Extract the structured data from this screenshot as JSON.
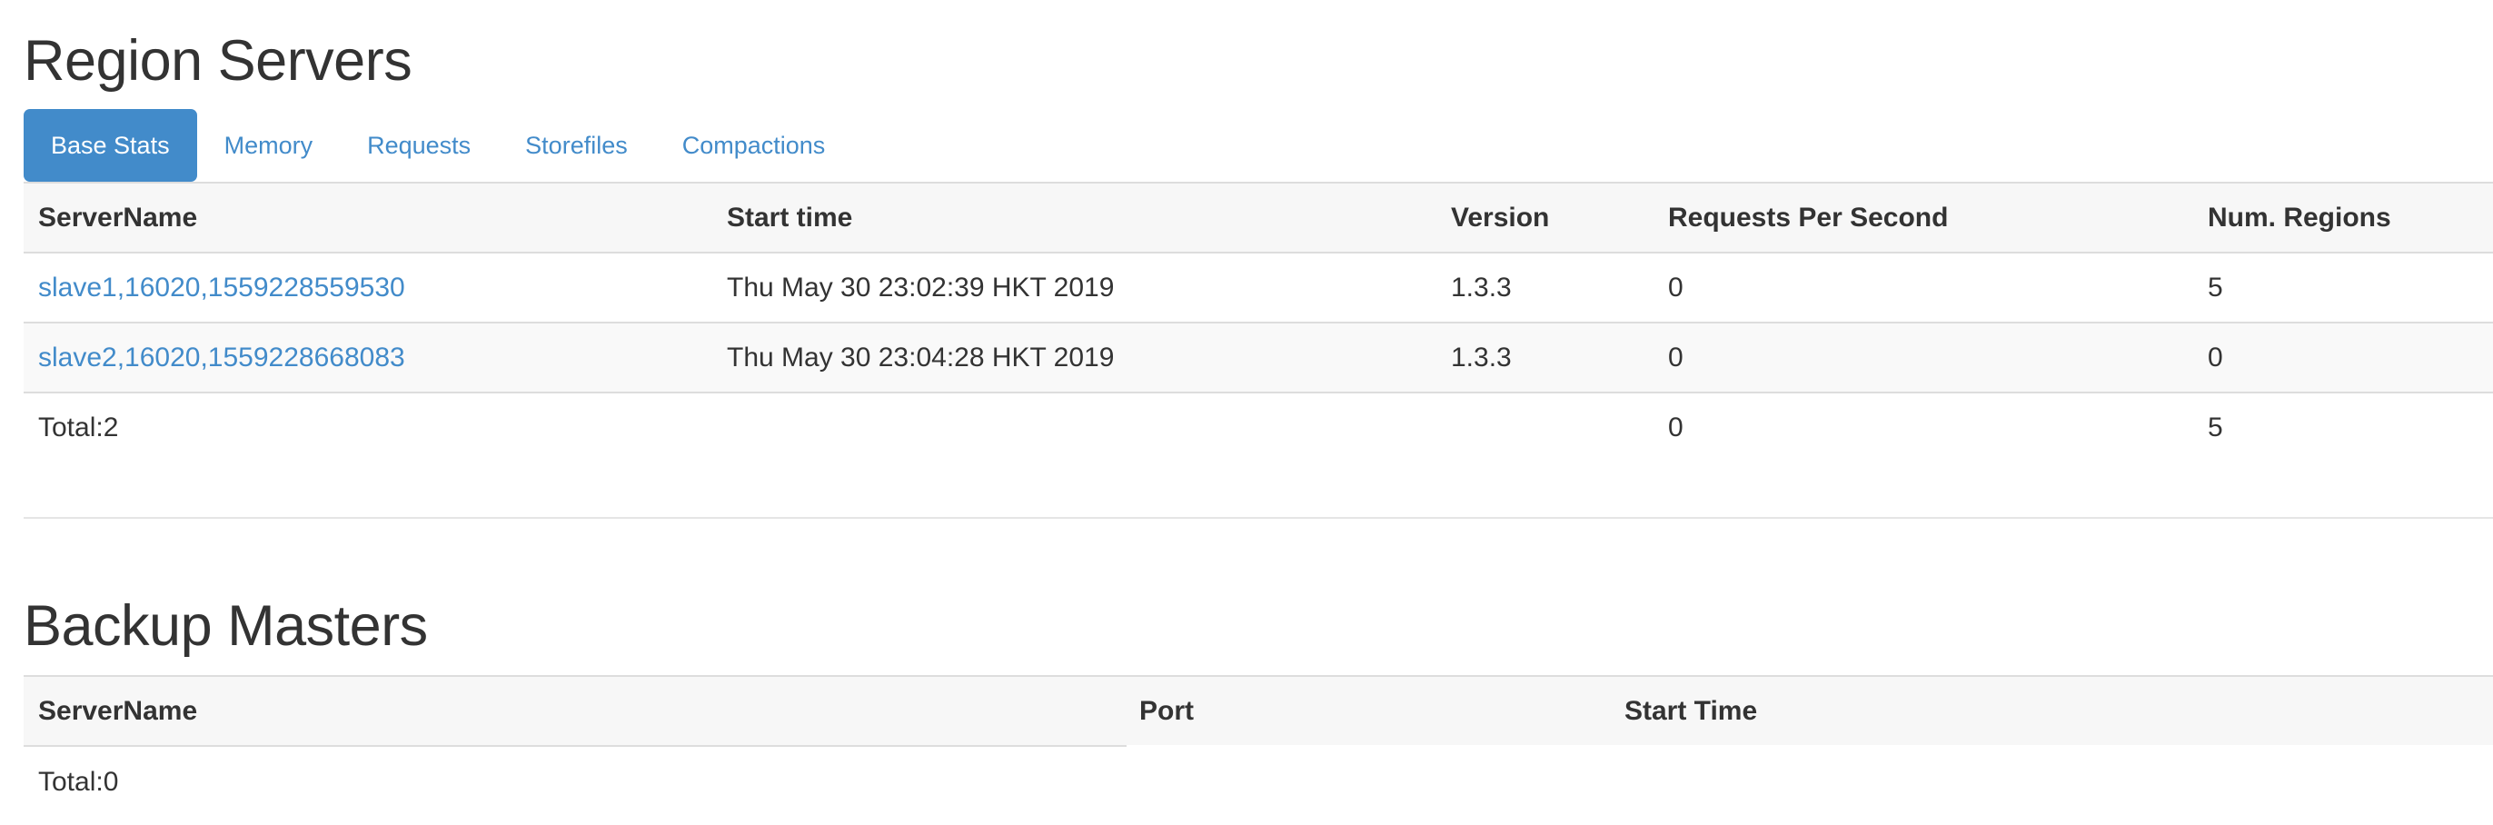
{
  "region_servers": {
    "title": "Region Servers",
    "tabs": [
      "Base Stats",
      "Memory",
      "Requests",
      "Storefiles",
      "Compactions"
    ],
    "active_tab": "Base Stats",
    "columns": [
      "ServerName",
      "Start time",
      "Version",
      "Requests Per Second",
      "Num. Regions"
    ],
    "rows": [
      {
        "server_name": "slave1,16020,1559228559530",
        "start_time": "Thu May 30 23:02:39 HKT 2019",
        "version": "1.3.3",
        "requests_per_second": "0",
        "num_regions": "5"
      },
      {
        "server_name": "slave2,16020,1559228668083",
        "start_time": "Thu May 30 23:04:28 HKT 2019",
        "version": "1.3.3",
        "requests_per_second": "0",
        "num_regions": "0"
      }
    ],
    "total": {
      "label": "Total:2",
      "requests_per_second": "0",
      "num_regions": "5"
    }
  },
  "backup_masters": {
    "title": "Backup Masters",
    "columns": [
      "ServerName",
      "Port",
      "Start Time"
    ],
    "total_label": "Total:0"
  },
  "colors": {
    "accent": "#428bca",
    "text": "#333333",
    "header_bg": "#f7f7f7",
    "stripe_bg": "#f9f9f9",
    "border": "#dddddd"
  }
}
